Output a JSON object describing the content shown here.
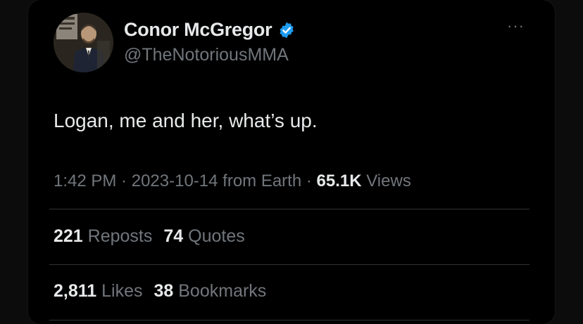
{
  "author": {
    "name": "Conor McGregor",
    "handle": "@TheNotoriousMMA",
    "verified_color": "#1d9bf0"
  },
  "icons": {
    "verified": "verified-badge-icon",
    "more": "more-options-icon",
    "more_glyph": "···"
  },
  "tweet": {
    "text": "Logan, me and her, what’s up."
  },
  "meta": {
    "time": "1:42 PM",
    "sep1": " · ",
    "date": "2023-10-14",
    "source": " from Earth",
    "sep2": " · ",
    "views_count": "65.1K",
    "views_label": " Views"
  },
  "stats": {
    "reposts_count": "221",
    "reposts_label": " Reposts",
    "quotes_count": "74",
    "quotes_label": " Quotes",
    "likes_count": "2,811",
    "likes_label": " Likes",
    "bookmarks_count": "38",
    "bookmarks_label": " Bookmarks"
  },
  "colors": {
    "background": "#000000",
    "primary_text": "#e7e9ea",
    "secondary_text": "#71767b",
    "divider": "#2f3336"
  }
}
